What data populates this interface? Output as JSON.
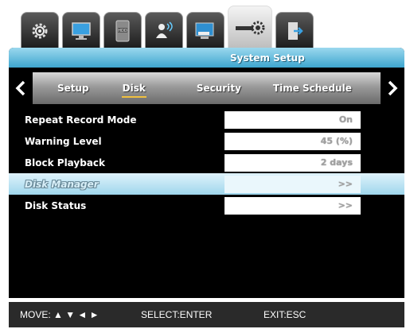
{
  "icon_tabs": [
    {
      "icon": "gear-icon",
      "active": false
    },
    {
      "icon": "monitor-icon",
      "active": false
    },
    {
      "icon": "hdd-icon",
      "active": false
    },
    {
      "icon": "user-network-icon",
      "active": false
    },
    {
      "icon": "network-screen-icon",
      "active": false
    },
    {
      "icon": "system-setup-icon",
      "active": true
    },
    {
      "icon": "exit-door-icon",
      "active": false
    }
  ],
  "header": {
    "title": "System Setup"
  },
  "sub_tabs": [
    {
      "label": "Setup",
      "active": false
    },
    {
      "label": "Disk",
      "active": true
    },
    {
      "label": "Security",
      "active": false
    },
    {
      "label": "Time Schedule",
      "active": false
    }
  ],
  "settings": [
    {
      "label": "Repeat Record Mode",
      "value": "On",
      "selected": false
    },
    {
      "label": "Warning Level",
      "value": "45 (%)",
      "selected": false
    },
    {
      "label": "Block Playback",
      "value": "2 days",
      "selected": false
    },
    {
      "label": "Disk Manager",
      "value": ">>",
      "selected": true
    },
    {
      "label": "Disk Status",
      "value": ">>",
      "selected": false
    }
  ],
  "footer": {
    "move": "MOVE: ▲ ▼ ◄ ►",
    "select": "SELECT:ENTER",
    "exit": "EXIT:ESC"
  },
  "colors": {
    "title_bar": "#3ea6cf",
    "selected_row": "#9fd6ec",
    "active_tab_underline": "#f0c040"
  }
}
